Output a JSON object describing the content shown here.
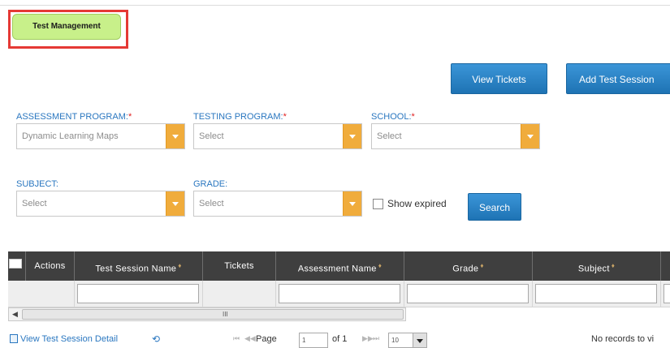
{
  "tab": {
    "label": "Test Management"
  },
  "buttons": {
    "view_tickets": "View Tickets",
    "add_test_session": "Add Test Session",
    "search": "Search"
  },
  "filters": {
    "assessment_program": {
      "label": "ASSESSMENT PROGRAM:",
      "required": "*",
      "value": "Dynamic Learning Maps"
    },
    "testing_program": {
      "label": "TESTING PROGRAM:",
      "required": "*",
      "value": "Select"
    },
    "school": {
      "label": "SCHOOL:",
      "required": "*",
      "value": "Select"
    },
    "subject": {
      "label": "SUBJECT:",
      "value": "Select"
    },
    "grade": {
      "label": "GRADE:",
      "value": "Select"
    },
    "show_expired": {
      "label": "Show expired",
      "checked": false
    }
  },
  "grid": {
    "columns": [
      {
        "label": "Actions",
        "sortable": false
      },
      {
        "label": "Test Session Name",
        "sortable": true
      },
      {
        "label": "Tickets",
        "sortable": false
      },
      {
        "label": "Assessment Name",
        "sortable": true
      },
      {
        "label": "Grade",
        "sortable": true
      },
      {
        "label": "Subject",
        "sortable": true
      }
    ],
    "sort_glyph": "♦",
    "scroll_grip": "III",
    "scroll_left": "◀"
  },
  "pager": {
    "detail_link": "View Test Session Detail",
    "refresh": "⟲",
    "first": "⏮",
    "prev": "◀◀",
    "page_label": "Page",
    "page_value": "1",
    "of_label": "of 1",
    "next": "▶▶",
    "last": "⏭",
    "page_size": "10",
    "no_records": "No records to vi"
  },
  "colors": {
    "accent_blue": "#2a83c7",
    "tab_green": "#c8f08a",
    "highlight_red": "#e53935",
    "select_arrow": "#f0ac3c",
    "grid_header": "#3f3f3f"
  }
}
